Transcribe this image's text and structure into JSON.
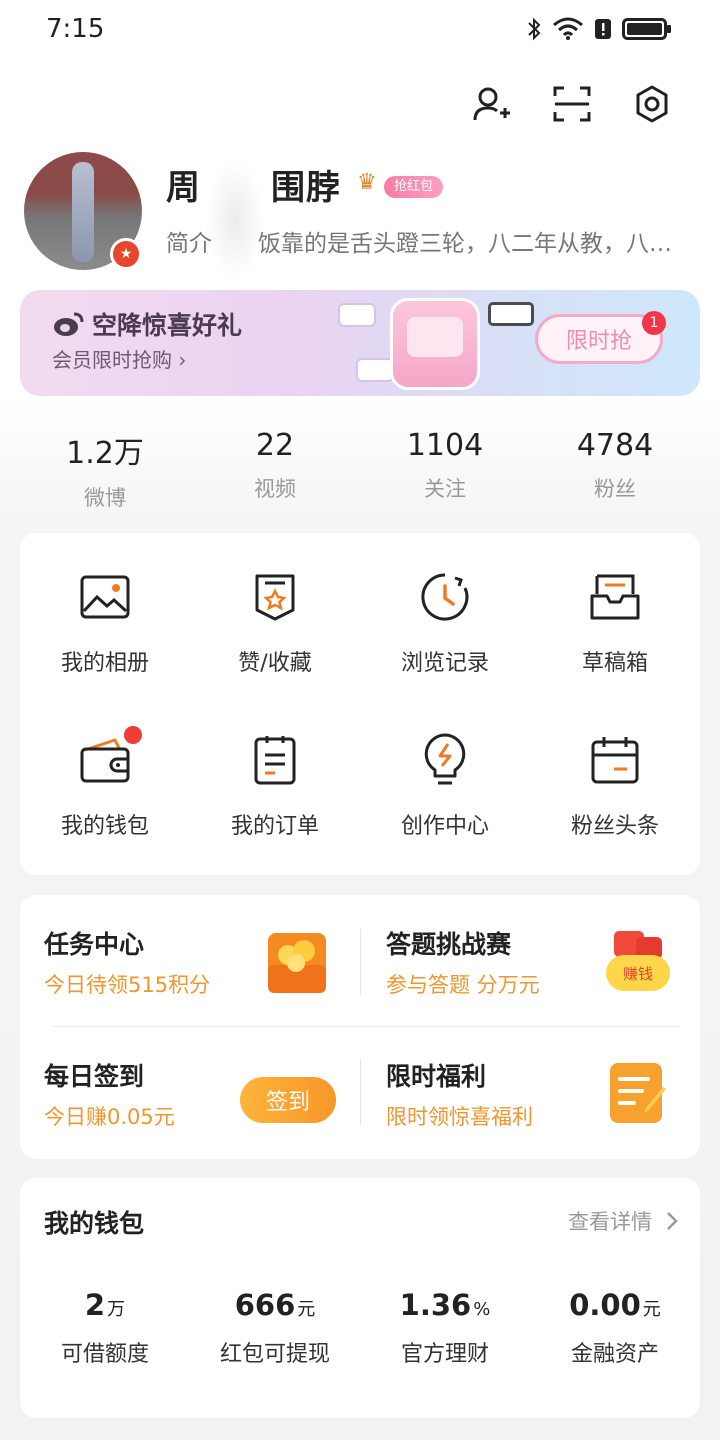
{
  "status_bar": {
    "time": "7:15"
  },
  "profile": {
    "username": "周　　围脖",
    "tag": "抢红包",
    "bio": "简介　　饭靠的是舌头蹬三轮，八二年从教，八…"
  },
  "banner": {
    "title": "空降惊喜好礼",
    "subtitle": "会员限时抢购 ›",
    "button": "限时抢",
    "badge": "1"
  },
  "stats": [
    {
      "value": "1.2万",
      "label": "微博"
    },
    {
      "value": "22",
      "label": "视频"
    },
    {
      "value": "1104",
      "label": "关注"
    },
    {
      "value": "4784",
      "label": "粉丝"
    }
  ],
  "grid": [
    {
      "label": "我的相册",
      "icon": "photo-album-icon"
    },
    {
      "label": "赞/收藏",
      "icon": "favorites-icon"
    },
    {
      "label": "浏览记录",
      "icon": "history-clock-icon"
    },
    {
      "label": "草稿箱",
      "icon": "drafts-inbox-icon"
    },
    {
      "label": "我的钱包",
      "icon": "wallet-icon"
    },
    {
      "label": "我的订单",
      "icon": "orders-icon"
    },
    {
      "label": "创作中心",
      "icon": "lightbulb-icon"
    },
    {
      "label": "粉丝头条",
      "icon": "calendar-icon"
    }
  ],
  "tasks": {
    "task_center": {
      "title": "任务中心",
      "subtitle": "今日待领515积分"
    },
    "quiz": {
      "title": "答题挑战赛",
      "subtitle": "参与答题 分万元",
      "badge": "赚钱"
    },
    "daily_sign": {
      "title": "每日签到",
      "subtitle": "今日赚0.05元",
      "button": "签到"
    },
    "limited_benefit": {
      "title": "限时福利",
      "subtitle": "限时领惊喜福利"
    }
  },
  "wallet": {
    "title": "我的钱包",
    "more": "查看详情",
    "items": [
      {
        "value": "2",
        "unit": "万",
        "label": "可借额度"
      },
      {
        "value": "666",
        "unit": "元",
        "label": "红包可提现"
      },
      {
        "value": "1.36",
        "unit": "%",
        "label": "官方理财"
      },
      {
        "value": "0.00",
        "unit": "元",
        "label": "金融资产"
      }
    ]
  },
  "colors": {
    "accent": "#f0962d",
    "red": "#f23c36",
    "text": "#222222",
    "muted": "#999999"
  }
}
